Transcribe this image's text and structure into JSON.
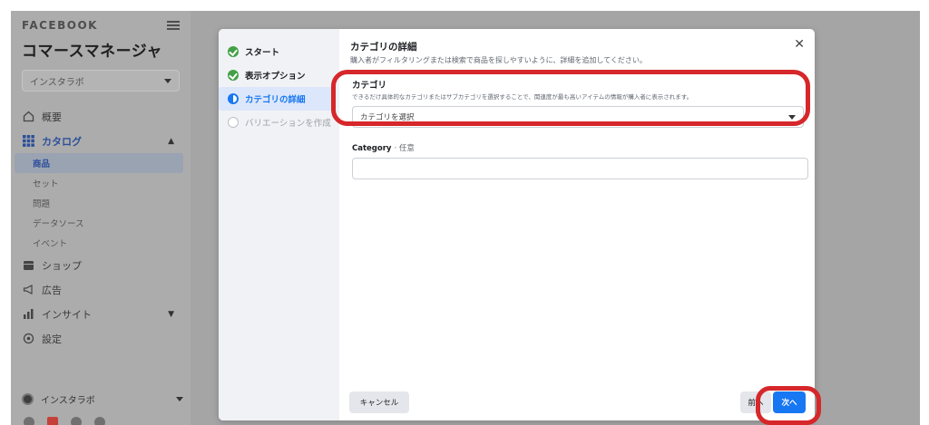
{
  "sidebar": {
    "brand": "FACEBOOK",
    "title": "コマースマネージャ",
    "shop_selector": "インスタラボ",
    "nav": [
      {
        "label": "概要",
        "icon": "home-icon"
      },
      {
        "label": "カタログ",
        "icon": "grid-icon",
        "active": true
      },
      {
        "label": "ショップ",
        "icon": "shop-icon"
      },
      {
        "label": "広告",
        "icon": "megaphone-icon"
      },
      {
        "label": "インサイト",
        "icon": "bar-chart-icon"
      },
      {
        "label": "設定",
        "icon": "gear-icon"
      }
    ],
    "catalog_sub": [
      "商品",
      "セット",
      "問題",
      "データソース",
      "イベント"
    ],
    "account": "インスタラボ"
  },
  "modal": {
    "steps": [
      {
        "label": "スタート",
        "state": "done"
      },
      {
        "label": "表示オプション",
        "state": "done"
      },
      {
        "label": "カテゴリの詳細",
        "state": "current"
      },
      {
        "label": "バリエーションを作成",
        "state": "pending"
      }
    ],
    "title": "カテゴリの詳細",
    "subtitle": "購入者がフィルタリングまたは検索で商品を探しやすいように、詳細を追加してください。",
    "category": {
      "label": "カテゴリ",
      "help": "できるだけ具体的なカテゴリまたはサブカテゴリを選択することで、関連度が最も高いアイテムの情報が購入者に表示されます。",
      "placeholder": "カテゴリを選択"
    },
    "category_field": {
      "label": "Category",
      "optional": "· 任意"
    },
    "buttons": {
      "cancel": "キャンセル",
      "prev": "前へ",
      "next": "次へ"
    }
  },
  "colors": {
    "primary": "#1877f2",
    "done": "#42a047",
    "highlight": "#d6272a"
  }
}
